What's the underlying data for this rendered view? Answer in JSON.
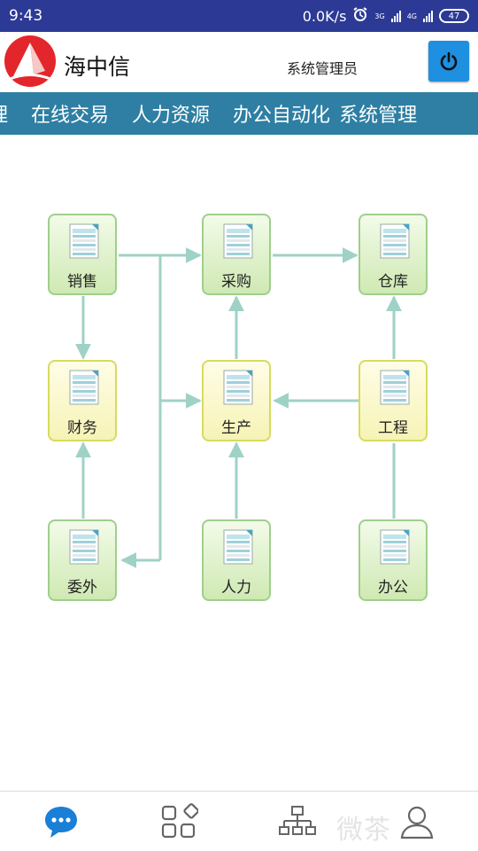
{
  "status_bar": {
    "time": "9:43",
    "speed": "0.0K/s",
    "net1": "3G",
    "net2": "4G",
    "battery": "47"
  },
  "header": {
    "brand": "海中信",
    "role": "系统管理员"
  },
  "nav": {
    "items": [
      "理",
      "在线交易",
      "人力资源",
      "办公自动化",
      "系统管理"
    ]
  },
  "flow": {
    "nodes": {
      "sales": "销售",
      "purchase": "采购",
      "warehouse": "仓库",
      "finance": "财务",
      "production": "生产",
      "engineering": "工程",
      "outsourcing": "委外",
      "hr": "人力",
      "office": "办公"
    }
  },
  "bottom_nav": {
    "icons": [
      "chat-bubble-icon",
      "apps-grid-icon",
      "org-chart-icon",
      "user-icon"
    ],
    "watermark": "微茶"
  }
}
